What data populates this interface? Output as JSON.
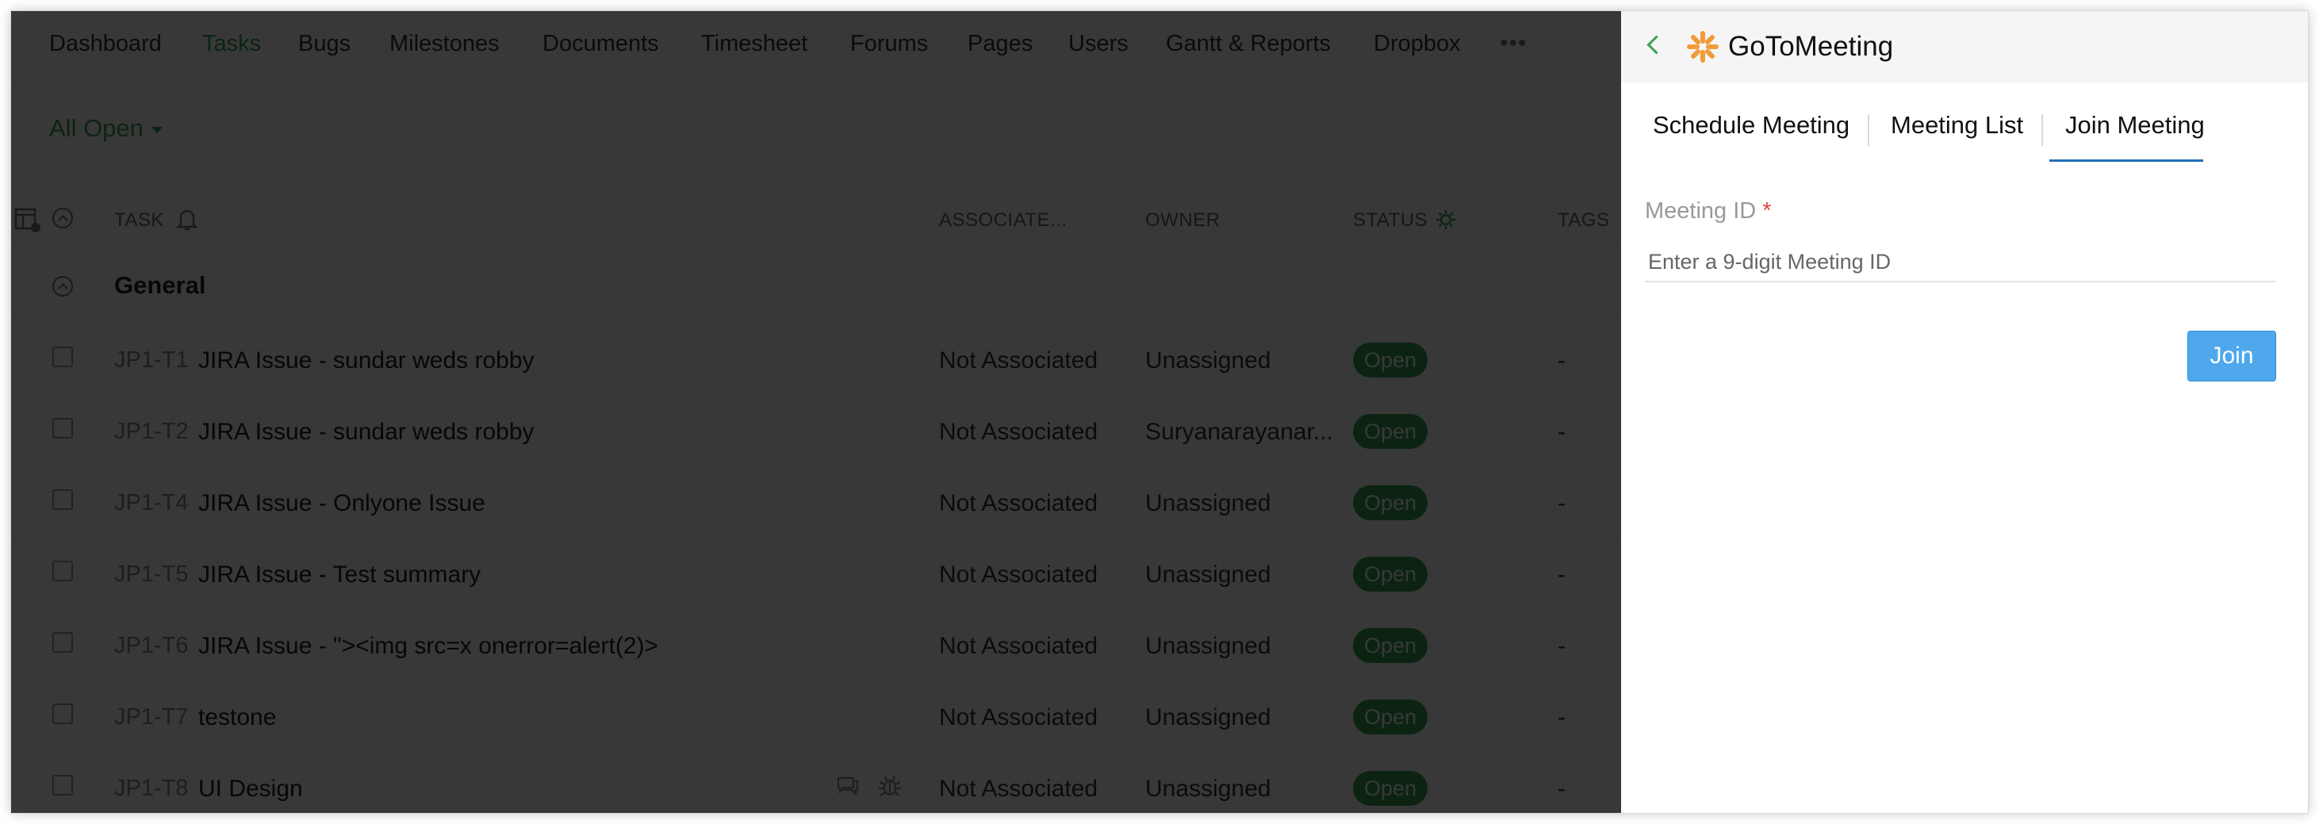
{
  "nav": {
    "items": [
      {
        "label": "Dashboard"
      },
      {
        "label": "Tasks"
      },
      {
        "label": "Bugs"
      },
      {
        "label": "Milestones"
      },
      {
        "label": "Documents"
      },
      {
        "label": "Timesheet"
      },
      {
        "label": "Forums"
      },
      {
        "label": "Pages"
      },
      {
        "label": "Users"
      },
      {
        "label": "Gantt & Reports"
      },
      {
        "label": "Dropbox"
      }
    ],
    "active": "Tasks",
    "more": "•••"
  },
  "filter": {
    "label": "All Open"
  },
  "table": {
    "columns": {
      "task": "TASK",
      "associated": "ASSOCIATE...",
      "owner": "OWNER",
      "status": "STATUS",
      "tags": "TAGS"
    },
    "group": "General",
    "rows": [
      {
        "id": "JP1-T1",
        "name": "JIRA Issue - sundar weds robby",
        "associated": "Not Associated",
        "owner": "Unassigned",
        "status": "Open",
        "tags": "-"
      },
      {
        "id": "JP1-T2",
        "name": "JIRA Issue - sundar weds robby",
        "associated": "Not Associated",
        "owner": "Suryanarayanar...",
        "status": "Open",
        "tags": "-"
      },
      {
        "id": "JP1-T4",
        "name": "JIRA Issue - Onlyone Issue",
        "associated": "Not Associated",
        "owner": "Unassigned",
        "status": "Open",
        "tags": "-"
      },
      {
        "id": "JP1-T5",
        "name": "JIRA Issue - Test summary",
        "associated": "Not Associated",
        "owner": "Unassigned",
        "status": "Open",
        "tags": "-"
      },
      {
        "id": "JP1-T6",
        "name": "JIRA Issue - \"><img src=x onerror=alert(2)>",
        "associated": "Not Associated",
        "owner": "Unassigned",
        "status": "Open",
        "tags": "-"
      },
      {
        "id": "JP1-T7",
        "name": "testone",
        "associated": "Not Associated",
        "owner": "Unassigned",
        "status": "Open",
        "tags": "-"
      },
      {
        "id": "JP1-T8",
        "name": "UI Design",
        "associated": "Not Associated",
        "owner": "Unassigned",
        "status": "Open",
        "tags": "-"
      }
    ]
  },
  "panel": {
    "title": "GoToMeeting",
    "brand_icon": "gotomeeting-logo-icon",
    "brand_color": "#f39a3b",
    "tabs": [
      {
        "label": "Schedule Meeting"
      },
      {
        "label": "Meeting List"
      },
      {
        "label": "Join Meeting"
      }
    ],
    "active_tab": "Join Meeting",
    "meeting_id": {
      "label": "Meeting ID",
      "required_mark": "*",
      "placeholder": "Enter a 9-digit Meeting ID",
      "value": ""
    },
    "join_label": "Join"
  }
}
